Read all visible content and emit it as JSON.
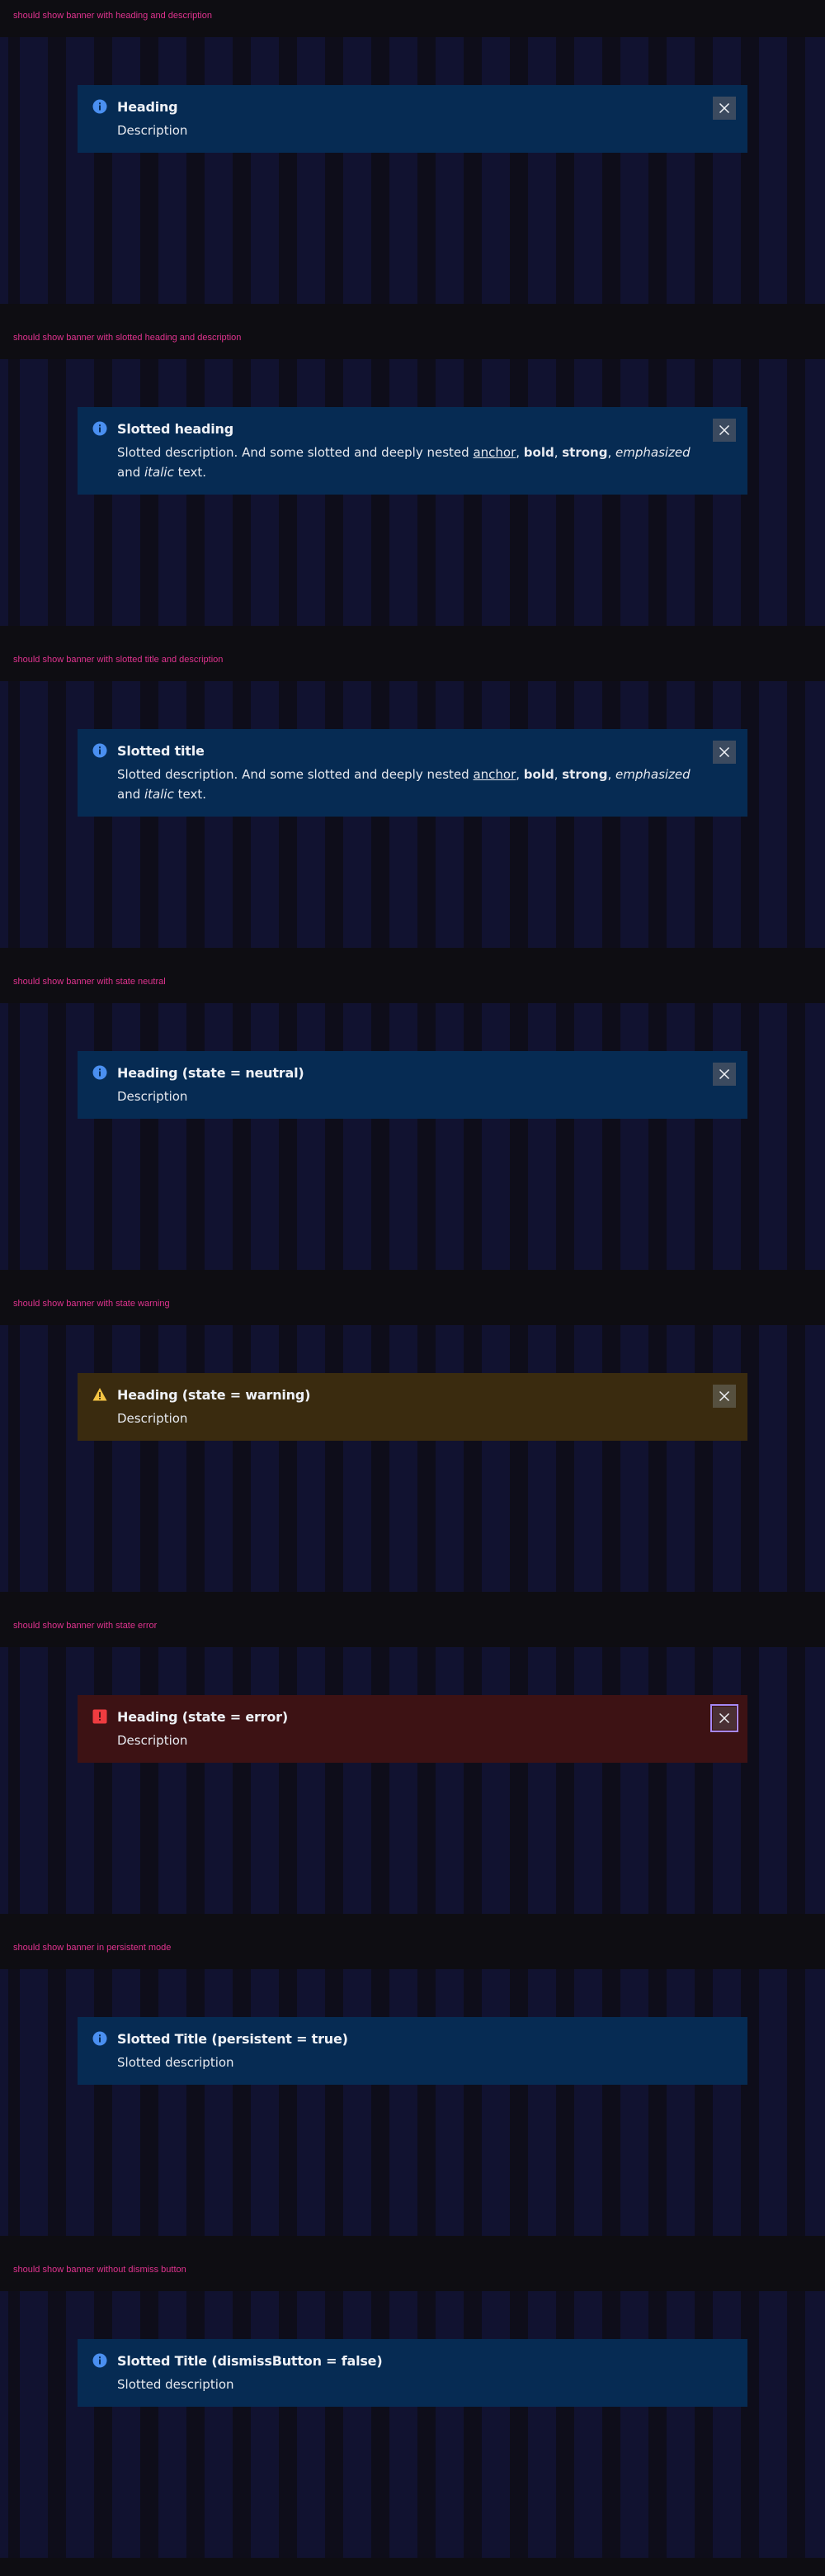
{
  "colors": {
    "label": "#e0338f",
    "info_bg": "#062b53",
    "warning_bg": "#3a2b0f",
    "error_bg": "#3d1214",
    "info_icon": "#4a8ff0",
    "warning_icon": "#f5c543",
    "error_icon": "#ef3c40"
  },
  "sections": [
    {
      "label": "should show banner with heading and description",
      "state": "info",
      "icon": "info-icon",
      "heading": "Heading",
      "description": "Description",
      "dismiss_icon": "close-icon",
      "dismiss_visible": true
    },
    {
      "label": "should show banner with slotted heading and description",
      "state": "info",
      "icon": "info-icon",
      "heading": "Slotted heading",
      "description_rich": {
        "before": "Slotted description. And some slotted and deeply nested ",
        "anchor": "anchor",
        "sep1": ", ",
        "bold": "bold",
        "sep2": ", ",
        "strong": "strong",
        "sep3": ", ",
        "emphasized": "emphasized",
        "and": " and ",
        "italic": "italic",
        "after": " text."
      },
      "dismiss_icon": "close-icon",
      "dismiss_visible": true
    },
    {
      "label": "should show banner with slotted title and description",
      "state": "info",
      "icon": "info-icon",
      "heading": "Slotted title",
      "description_rich": {
        "before": "Slotted description. And some slotted and deeply nested ",
        "anchor": "anchor",
        "sep1": ", ",
        "bold": "bold",
        "sep2": ", ",
        "strong": "strong",
        "sep3": ", ",
        "emphasized": "emphasized",
        "and": " and ",
        "italic": "italic",
        "after": " text."
      },
      "dismiss_icon": "close-icon",
      "dismiss_visible": true
    },
    {
      "label": "should show banner with state neutral",
      "state": "info",
      "icon": "info-icon",
      "heading": "Heading (state = neutral)",
      "description": "Description",
      "dismiss_icon": "close-icon",
      "dismiss_visible": true
    },
    {
      "label": "should show banner with state warning",
      "state": "warning",
      "icon": "warning-icon",
      "heading": "Heading (state = warning)",
      "description": "Description",
      "dismiss_icon": "close-icon",
      "dismiss_visible": true
    },
    {
      "label": "should show banner with state error",
      "state": "error",
      "icon": "error-icon",
      "heading": "Heading (state = error)",
      "description": "Description",
      "dismiss_icon": "close-icon",
      "dismiss_visible": true,
      "dismiss_focused": true
    },
    {
      "label": "should show banner in persistent mode",
      "state": "info",
      "icon": "info-icon",
      "heading": "Slotted Title (persistent = true)",
      "description": "Slotted description",
      "dismiss_visible": false
    },
    {
      "label": "should show banner without dismiss button",
      "state": "info",
      "icon": "info-icon",
      "heading": "Slotted Title (dismissButton = false)",
      "description": "Slotted description",
      "dismiss_visible": false
    }
  ]
}
